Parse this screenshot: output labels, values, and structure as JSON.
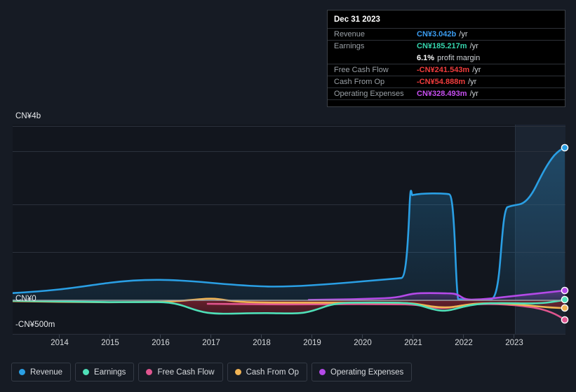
{
  "chart_data": {
    "type": "line",
    "title": "",
    "xlabel": "",
    "ylabel": "",
    "currency": "CN¥",
    "ylim": [
      -500000000,
      4000000000
    ],
    "grid": true,
    "legend_position": "bottom-left",
    "y_ticks": [
      {
        "label": "CN¥4b",
        "value": 4000000000
      },
      {
        "label": "CN¥0",
        "value": 0
      },
      {
        "label": "-CN¥500m",
        "value": -500000000
      }
    ],
    "x_ticks": [
      "2014",
      "2015",
      "2016",
      "2017",
      "2018",
      "2019",
      "2020",
      "2021",
      "2022",
      "2023"
    ],
    "x_range": [
      "2013-09",
      "2024-03"
    ],
    "series": [
      {
        "name": "Revenue",
        "color": "#2a9fe4",
        "x": [
          "2013-09",
          "2014",
          "2014-06",
          "2015",
          "2015-06",
          "2016",
          "2016-06",
          "2017",
          "2017-06",
          "2018",
          "2018-06",
          "2019",
          "2019-06",
          "2020",
          "2020-06",
          "2020-09",
          "2020-12",
          "2021",
          "2021-06",
          "2021-09",
          "2021-12",
          "2022",
          "2022-06",
          "2022-09",
          "2022-12",
          "2023",
          "2023-06",
          "2023-09",
          "2023-12"
        ],
        "values": [
          165000000,
          180000000,
          210000000,
          255000000,
          290000000,
          320000000,
          330000000,
          320000000,
          300000000,
          290000000,
          300000000,
          320000000,
          330000000,
          350000000,
          380000000,
          1980000000,
          2090000000,
          2100000000,
          2100000000,
          2090000000,
          2030000000,
          450000000,
          470000000,
          520000000,
          1830000000,
          1900000000,
          2250000000,
          2650000000,
          3042000000
        ]
      },
      {
        "name": "Earnings",
        "color": "#4fe0b8",
        "x": [
          "2013-09",
          "2014",
          "2015",
          "2016",
          "2016-06",
          "2017",
          "2017-06",
          "2018",
          "2018-06",
          "2019",
          "2020",
          "2021",
          "2021-06",
          "2022",
          "2022-06",
          "2023",
          "2023-06",
          "2023-12"
        ],
        "values": [
          -5000000,
          -10000000,
          -15000000,
          -30000000,
          -90000000,
          -130000000,
          -120000000,
          -115000000,
          -125000000,
          -60000000,
          -35000000,
          -30000000,
          -25000000,
          -40000000,
          -90000000,
          -45000000,
          -30000000,
          185217000
        ]
      },
      {
        "name": "Free Cash Flow",
        "color": "#e0558f",
        "x": [
          "2016-09",
          "2017",
          "2018",
          "2019",
          "2020",
          "2021",
          "2021-06",
          "2022",
          "2022-06",
          "2023",
          "2023-06",
          "2023-12"
        ],
        "values": [
          -40000000,
          -45000000,
          -45000000,
          -42000000,
          -40000000,
          -40000000,
          -55000000,
          -42000000,
          -40000000,
          -45000000,
          -80000000,
          -241543000
        ]
      },
      {
        "name": "Cash From Op",
        "color": "#f0b354",
        "x": [
          "2013-09",
          "2014",
          "2015",
          "2016",
          "2016-06",
          "2017",
          "2018",
          "2019",
          "2020",
          "2021",
          "2021-06",
          "2022",
          "2022-06",
          "2023",
          "2023-06",
          "2023-12"
        ],
        "values": [
          -10000000,
          -18000000,
          -20000000,
          -22000000,
          10000000,
          -8000000,
          -15000000,
          -18000000,
          -15000000,
          -18000000,
          -25000000,
          -18000000,
          -12000000,
          -20000000,
          -30000000,
          -54888000
        ]
      },
      {
        "name": "Operating Expenses",
        "color": "#b44ae8",
        "x": [
          "2019-03",
          "2020",
          "2020-09",
          "2021",
          "2021-06",
          "2022",
          "2022-06",
          "2023",
          "2023-06",
          "2023-12"
        ],
        "values": [
          8000000,
          15000000,
          85000000,
          90000000,
          88000000,
          45000000,
          110000000,
          150000000,
          230000000,
          328493000
        ]
      }
    ],
    "highlight_band": {
      "from": "2023-04",
      "to": "2024-03",
      "label": ""
    }
  },
  "tooltip": {
    "date": "Dec 31 2023",
    "rows": [
      {
        "label": "Revenue",
        "value": "CN¥3.042b",
        "unit": "/yr",
        "color": "#3b9cf0"
      },
      {
        "label": "Earnings",
        "value": "CN¥185.217m",
        "unit": "/yr",
        "color": "#35d6ae"
      },
      {
        "label": "",
        "value": "6.1%",
        "unit": "profit margin",
        "color": "#ffffff"
      },
      {
        "label": "Free Cash Flow",
        "value": "-CN¥241.543m",
        "unit": "/yr",
        "color": "#f03c3c"
      },
      {
        "label": "Cash From Op",
        "value": "-CN¥54.888m",
        "unit": "/yr",
        "color": "#f03c3c"
      },
      {
        "label": "Operating Expenses",
        "value": "CN¥328.493m",
        "unit": "/yr",
        "color": "#c64ff0"
      }
    ]
  },
  "y_axis": {
    "top": "CN¥4b",
    "zero": "CN¥0",
    "bottom": "-CN¥500m"
  },
  "x_axis": {
    "ticks": [
      "2014",
      "2015",
      "2016",
      "2017",
      "2018",
      "2019",
      "2020",
      "2021",
      "2022",
      "2023"
    ]
  },
  "legend": {
    "items": [
      {
        "label": "Revenue",
        "color": "#2a9fe4"
      },
      {
        "label": "Earnings",
        "color": "#4fe0b8"
      },
      {
        "label": "Free Cash Flow",
        "color": "#e0558f"
      },
      {
        "label": "Cash From Op",
        "color": "#f0b354"
      },
      {
        "label": "Operating Expenses",
        "color": "#b44ae8"
      }
    ]
  },
  "theme": {
    "background": "#161b24",
    "plot_background": "#12161e",
    "grid_color": "#2b313c",
    "zero_line_color": "#9aa0a6",
    "highlight_band": "#1b2431",
    "tooltip_background": "#000000",
    "tooltip_border": "#3a3f46",
    "axis_text": "#d7dadd"
  }
}
